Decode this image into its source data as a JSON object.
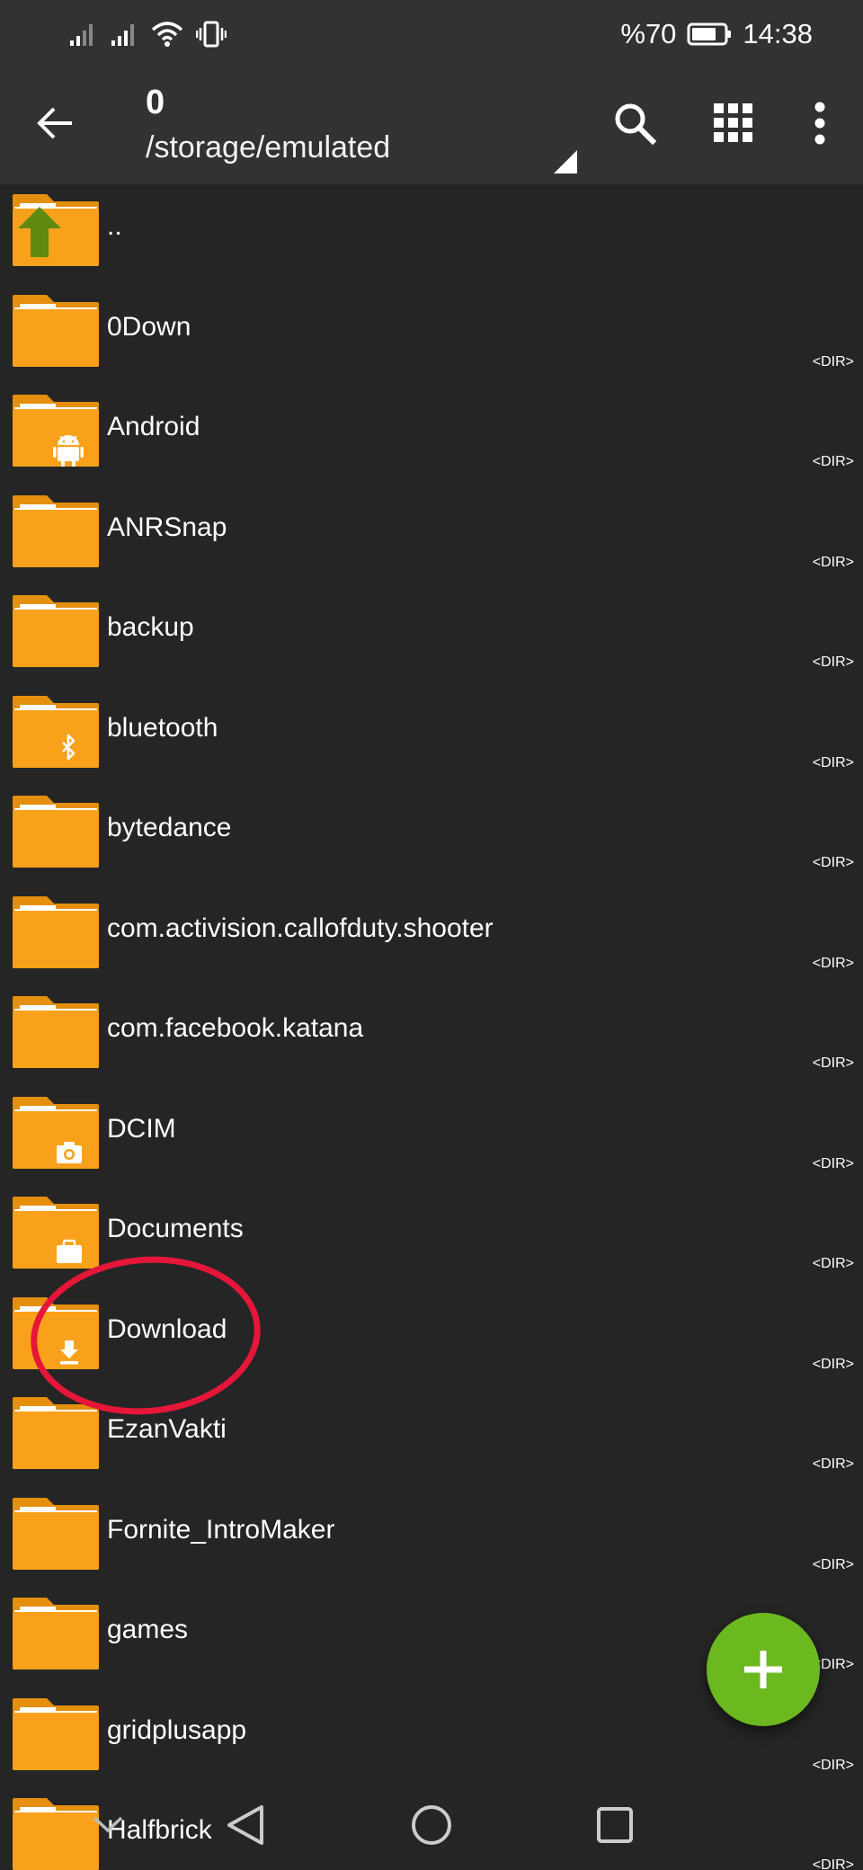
{
  "status_bar": {
    "battery_percent": "%70",
    "time": "14:38",
    "icons": [
      "signal-icon",
      "signal-icon",
      "wifi-icon",
      "vibrate-icon",
      "battery-icon"
    ]
  },
  "toolbar": {
    "title": "0",
    "path": "/storage/emulated",
    "icons": [
      "back-arrow-icon",
      "search-icon",
      "grid-view-icon",
      "more-vert-icon"
    ]
  },
  "files": [
    {
      "name": "..",
      "icon": "folder-up-icon",
      "dir": ""
    },
    {
      "name": "0Down",
      "icon": "folder-icon",
      "dir": "<DIR>"
    },
    {
      "name": "Android",
      "icon": "folder-android-icon",
      "dir": "<DIR>"
    },
    {
      "name": "ANRSnap",
      "icon": "folder-icon",
      "dir": "<DIR>"
    },
    {
      "name": "backup",
      "icon": "folder-icon",
      "dir": "<DIR>"
    },
    {
      "name": "bluetooth",
      "icon": "folder-bluetooth-icon",
      "dir": "<DIR>"
    },
    {
      "name": "bytedance",
      "icon": "folder-icon",
      "dir": "<DIR>"
    },
    {
      "name": "com.activision.callofduty.shooter",
      "icon": "folder-icon",
      "dir": "<DIR>"
    },
    {
      "name": "com.facebook.katana",
      "icon": "folder-icon",
      "dir": "<DIR>"
    },
    {
      "name": "DCIM",
      "icon": "folder-camera-icon",
      "dir": "<DIR>"
    },
    {
      "name": "Documents",
      "icon": "folder-briefcase-icon",
      "dir": "<DIR>"
    },
    {
      "name": "Download",
      "icon": "folder-download-icon",
      "dir": "<DIR>"
    },
    {
      "name": "EzanVakti",
      "icon": "folder-icon",
      "dir": "<DIR>"
    },
    {
      "name": "Fornite_IntroMaker",
      "icon": "folder-icon",
      "dir": "<DIR>"
    },
    {
      "name": "games",
      "icon": "folder-icon",
      "dir": "<DIR>"
    },
    {
      "name": "gridplusapp",
      "icon": "folder-icon",
      "dir": "<DIR>"
    },
    {
      "name": "Halfbrick",
      "icon": "folder-icon",
      "dir": "<DIR>"
    }
  ],
  "fab": {
    "icon": "plus-icon",
    "color": "#6cb81f"
  },
  "nav_bar": {
    "icons": [
      "hide-nav-icon",
      "nav-back-icon",
      "nav-home-icon",
      "nav-recent-icon"
    ]
  },
  "annotation": {
    "type": "circle",
    "target": "Download",
    "color": "#e6163a"
  },
  "colors": {
    "background": "#252525",
    "bar": "#323232",
    "folder": "#f9a11b",
    "folder_dark": "#e58f0e"
  }
}
